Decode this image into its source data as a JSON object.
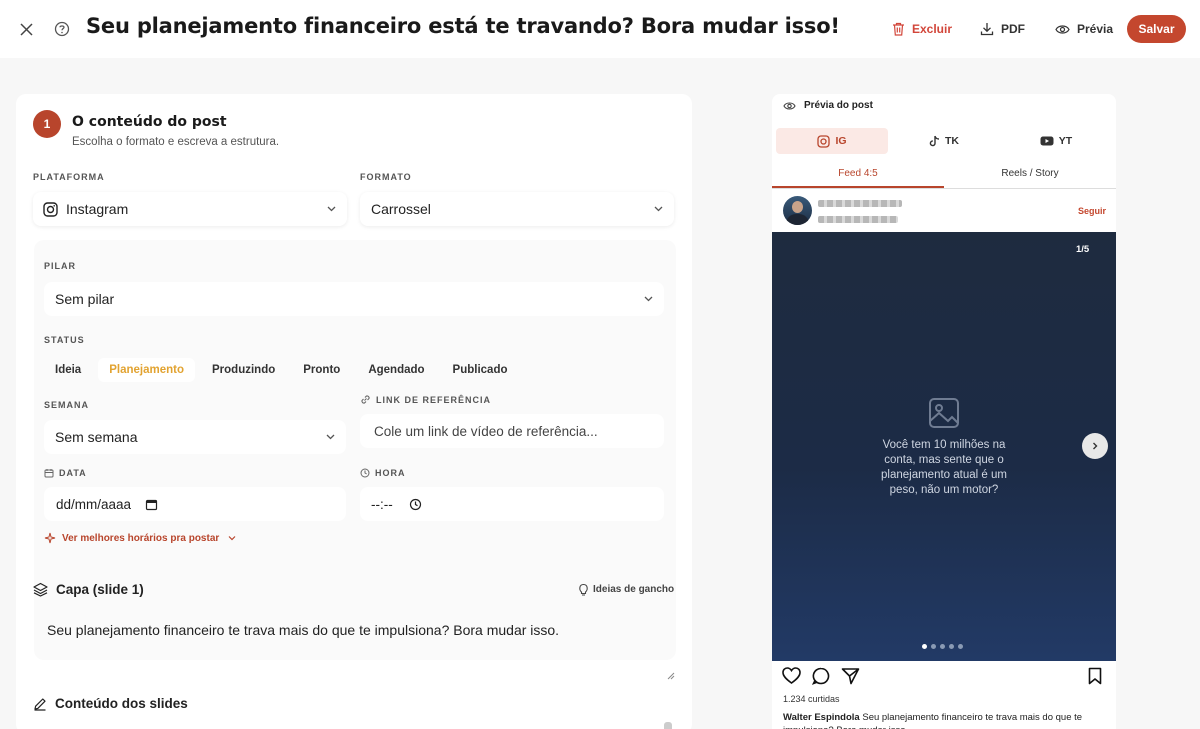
{
  "header": {
    "title": "Seu planejamento financeiro está te travando? Bora mudar isso!",
    "delete_label": "Excluir",
    "pdf_label": "PDF",
    "preview_label": "Prévia",
    "save_label": "Salvar"
  },
  "step": {
    "number": "1",
    "title": "O conteúdo do post",
    "subtitle": "Escolha o formato e escreva a estrutura."
  },
  "fields": {
    "platform_label": "PLATAFORMA",
    "platform_value": "Instagram",
    "format_label": "FORMATO",
    "format_value": "Carrossel",
    "pillar_label": "PILAR",
    "pillar_value": "Sem pilar",
    "status_label": "STATUS",
    "status_options": [
      "Ideia",
      "Planejamento",
      "Produzindo",
      "Pronto",
      "Agendado",
      "Publicado"
    ],
    "status_selected": "Planejamento",
    "week_label": "SEMANA",
    "week_value": "Sem semana",
    "reference_label": "LINK DE REFERÊNCIA",
    "reference_placeholder": "Cole um link de vídeo de referência...",
    "date_label": "DATA",
    "date_placeholder": "dd/mm/aaaa",
    "time_label": "HORA",
    "time_placeholder": "--:--",
    "best_times_label": "Ver melhores horários pra postar"
  },
  "cover": {
    "title": "Capa (slide 1)",
    "hook_ideas_label": "Ideias de gancho",
    "text": "Seu planejamento financeiro te trava mais do que te impulsiona? Bora mudar isso."
  },
  "slides_content": {
    "title": "Conteúdo dos slides"
  },
  "preview": {
    "header_label": "Prévia do post",
    "platform_tabs": [
      "IG",
      "TK",
      "YT"
    ],
    "platform_selected": "IG",
    "format_tabs": [
      "Feed 4:5",
      "Reels / Story"
    ],
    "format_selected": "Feed 4:5",
    "follow_label": "Seguir",
    "slide_counter": "1/5",
    "slide_text": "Você tem 10 milhões na conta, mas sente que o planejamento atual é um peso, não um motor?",
    "slide_dots_total": 5,
    "slide_dot_active": 1,
    "likes": "1.234 curtidas",
    "caption_user": "Walter Espindola",
    "caption_text": "Seu planejamento financeiro te trava mais do que te impulsiona? Bora mudar isso."
  },
  "colors": {
    "accent": "#c4472e",
    "status_active": "#e2a331",
    "delete": "#d2463a",
    "slide_bg": "#1e2b3f"
  }
}
